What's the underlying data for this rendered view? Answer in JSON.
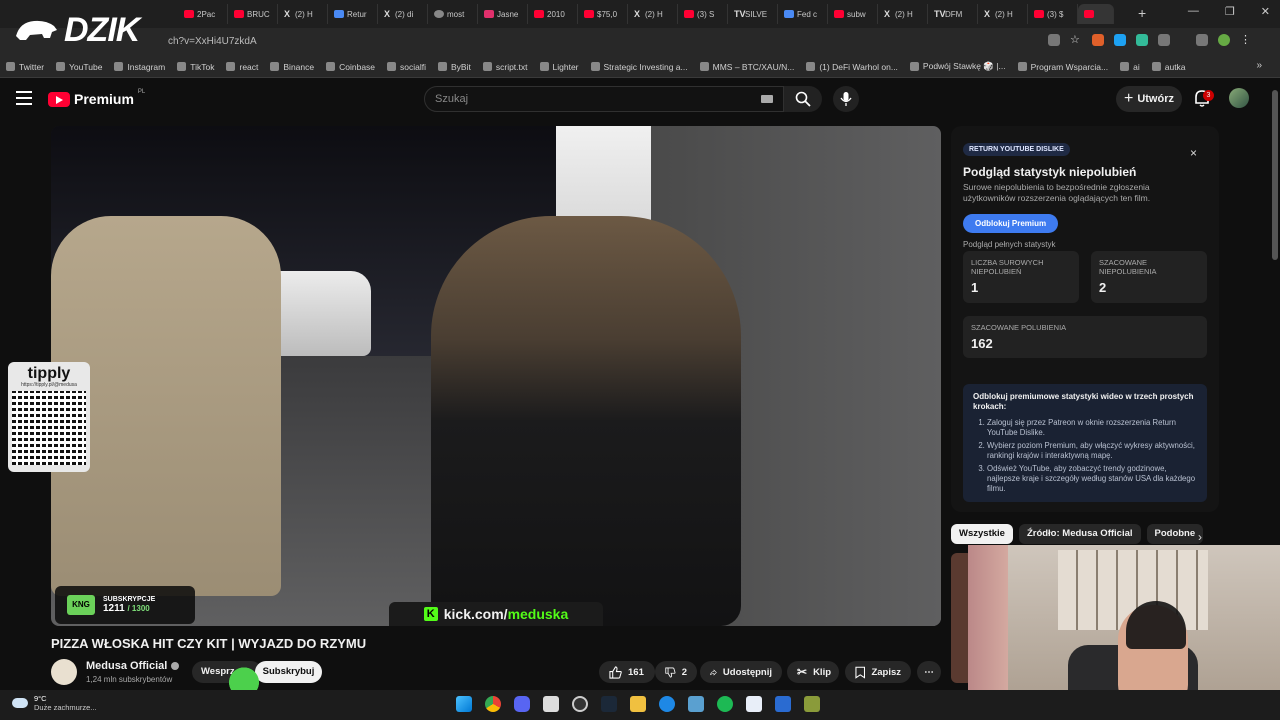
{
  "browser": {
    "tabs": [
      {
        "label": "2Pac",
        "icon": "youtube"
      },
      {
        "label": "BRUC",
        "icon": "youtube"
      },
      {
        "label": "(2) H",
        "icon": "x"
      },
      {
        "label": "Retur",
        "icon": "doc"
      },
      {
        "label": "(2) di",
        "icon": "x"
      },
      {
        "label": "most",
        "icon": "google"
      },
      {
        "label": "Jasne",
        "icon": "instagram"
      },
      {
        "label": "2010",
        "icon": "youtube"
      },
      {
        "label": "$75,0",
        "icon": "youtube"
      },
      {
        "label": "(2) H",
        "icon": "x"
      },
      {
        "label": "(3) S",
        "icon": "youtube"
      },
      {
        "label": "SILVE",
        "icon": "tv"
      },
      {
        "label": "Fed c",
        "icon": "doc"
      },
      {
        "label": "subw",
        "icon": "youtube"
      },
      {
        "label": "(2) H",
        "icon": "x"
      },
      {
        "label": "DFM",
        "icon": "tv"
      },
      {
        "label": "(2) H",
        "icon": "x"
      },
      {
        "label": "(3) $",
        "icon": "youtube"
      },
      {
        "label": "",
        "icon": "youtube",
        "active": true
      }
    ],
    "new_tab": "+",
    "url": "ch?v=XxHi4U7zkdA",
    "bookmarks": [
      "Twitter",
      "YouTube",
      "Instagram",
      "TikTok",
      "react",
      "Binance",
      "Coinbase",
      "socialfi",
      "ByBit",
      "script.txt",
      "Lighter",
      "Strategic Investing a...",
      "MMS – BTC/XAU/N...",
      "(1) DeFi Warhol on...",
      "Podwój Stawkę 🎲 |...",
      "Program Wsparcia...",
      "ai",
      "autka"
    ],
    "bookmarks_more": "»"
  },
  "overlay_logo": "DZIK",
  "youtube": {
    "brand": "Premium",
    "region": "PL",
    "search_placeholder": "Szukaj",
    "create_label": "Utwórz",
    "notifications": "3"
  },
  "video": {
    "kick_prefix": "kick.com/",
    "kick_channel": "meduska",
    "sub_badge_label": "SUBSKRYPCJE",
    "sub_badge_brand": "KNG",
    "sub_count": "1211",
    "sub_goal": "/ 1300"
  },
  "tipply": {
    "title": "tipply",
    "url": "https://tipply.pl/@medusa"
  },
  "meta": {
    "title": "PIZZA WŁOSKA HIT CZY KIT | WYJAZD DO RZYMU",
    "channel": "Medusa Official",
    "subscribers": "1,24 mln subskrybentów",
    "support_label": "Wesprz",
    "subscribe_label": "Subskrybuj",
    "likes": "161",
    "dislikes": "2",
    "share_label": "Udostępnij",
    "clip_label": "Klip",
    "save_label": "Zapisz",
    "more": "⋯"
  },
  "ryd": {
    "tag": "RETURN YOUTUBE DISLIKE",
    "close": "×",
    "title": "Podgląd statystyk niepolubień",
    "desc": "Surowe niepolubienia to bezpośrednie zgłoszenia użytkowników rozszerzenia oglądających ten film.",
    "unlock_button": "Odblokuj Premium",
    "preview_text": "Podgląd pełnych statystyk",
    "stats": [
      {
        "label": "LICZBA SUROWYCH NIEPOLUBIEŃ",
        "value": "1"
      },
      {
        "label": "SZACOWANE NIEPOLUBIENIA",
        "value": "2"
      },
      {
        "label": "SZACOWANE POLUBIENIA",
        "value": "162"
      }
    ],
    "promo_title": "Odblokuj premiumowe statystyki wideo w trzech prostych krokach:",
    "promo_steps": [
      "Zaloguj się przez Patreon w oknie rozszerzenia Return YouTube Dislike.",
      "Wybierz poziom Premium, aby włączyć wykresy aktywności, rankingi krajów i interaktywną mapę.",
      "Odśwież YouTube, aby zobaczyć trendy godzinowe, najlepsze kraje i szczegóły według stanów USA dla każdego filmu."
    ]
  },
  "chips": [
    "Wszystkie",
    "Źródło: Medusa Official",
    "Podobne"
  ],
  "chip_next": "›",
  "taskbar": {
    "temp": "9°C",
    "weather": "Duże zachmurze..."
  },
  "colors": {
    "yt_red": "#ff0033",
    "kick_green": "#53fc18",
    "ryd_blue": "#3e7bf0"
  }
}
